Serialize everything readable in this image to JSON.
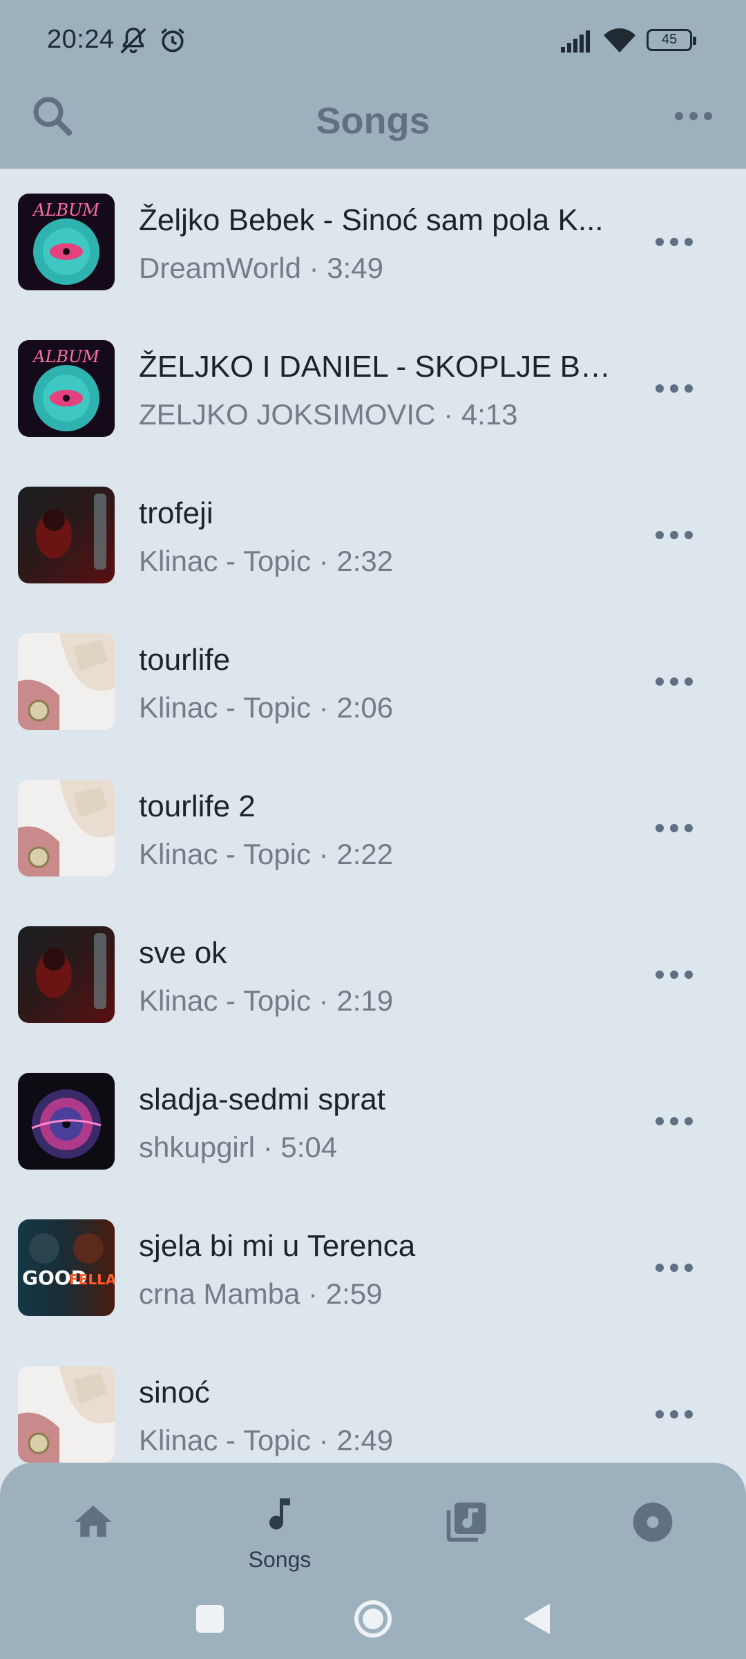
{
  "status": {
    "time": "20:24",
    "battery": "45"
  },
  "appbar": {
    "title": "Songs"
  },
  "songs": [
    {
      "title": "Željko Bebek - Sinoć sam pola K...",
      "artist": "DreamWorld",
      "duration": "3:49",
      "sub": "DreamWorld · 3:49",
      "art": "album"
    },
    {
      "title": "ŽELJKO I DANIEL -  SKOPLJE BE...",
      "artist": "ZELJKO JOKSIMOVIC",
      "duration": "4:13",
      "sub": "ZELJKO JOKSIMOVIC · 4:13",
      "art": "album"
    },
    {
      "title": "trofeji",
      "artist": "Klinac - Topic",
      "duration": "2:32",
      "sub": "Klinac - Topic · 2:32",
      "art": "dark-red"
    },
    {
      "title": "tourlife",
      "artist": "Klinac - Topic",
      "duration": "2:06",
      "sub": "Klinac - Topic · 2:06",
      "art": "hands"
    },
    {
      "title": "tourlife 2",
      "artist": "Klinac - Topic",
      "duration": "2:22",
      "sub": "Klinac - Topic · 2:22",
      "art": "hands"
    },
    {
      "title": "sve ok",
      "artist": "Klinac - Topic",
      "duration": "2:19",
      "sub": "Klinac - Topic · 2:19",
      "art": "dark-red"
    },
    {
      "title": "sladja-sedmi sprat",
      "artist": "shkupgirl",
      "duration": "5:04",
      "sub": "shkupgirl · 5:04",
      "art": "vinyl"
    },
    {
      "title": "sjela bi mi u Terenca",
      "artist": "crna Mamba",
      "duration": "2:59",
      "sub": "crna Mamba · 2:59",
      "art": "goodfellas"
    },
    {
      "title": "sinoć",
      "artist": "Klinac - Topic",
      "duration": "2:49",
      "sub": "Klinac - Topic · 2:49",
      "art": "hands"
    }
  ],
  "art_labels": {
    "album": "ALBUM",
    "goodfellas_a": "GOOD",
    "goodfellas_b": "FELLAS"
  },
  "bottom_nav": [
    {
      "icon": "home-icon",
      "label": ""
    },
    {
      "icon": "music-note-icon",
      "label": "Songs",
      "selected": true
    },
    {
      "icon": "album-library-icon",
      "label": ""
    },
    {
      "icon": "disc-icon",
      "label": ""
    }
  ],
  "colors": {
    "topbar": "#9cb0be",
    "background": "#dde5ed",
    "title": "#5e7081",
    "primary_text": "#1c232a",
    "secondary_text": "#727d87"
  }
}
